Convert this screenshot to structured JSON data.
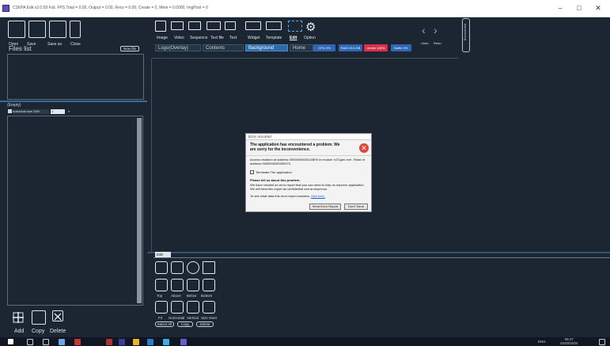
{
  "window": {
    "title": "CSKPA Edit v2.0.59 Full. FPS Total = 0.00, Output = 0.00, Recv = 0.00, Create = 0, Mem = 0.0000, ImgPool = 0",
    "minimize": "–",
    "maximize": "□",
    "close": "✕"
  },
  "file_toolbar": {
    "open": "Open",
    "save": "Save",
    "save_as": "Save as",
    "close": "Close"
  },
  "files": {
    "heading": "Files list",
    "new_file": "New file"
  },
  "layers": {
    "heading": "(Empty)",
    "checkbox_label": "Individual size 30%",
    "value": "1",
    "unit": "#"
  },
  "bottom_left": {
    "add": "Add",
    "copy": "Copy",
    "delete": "Delete"
  },
  "main_toolbar": {
    "items": [
      "Image",
      "Video",
      "Sequence",
      "Text file",
      "Text",
      "Widget",
      "Template",
      "Edit",
      "Option"
    ],
    "active": "Edit",
    "undo": "Undo",
    "redo": "Redo"
  },
  "tabs": [
    {
      "label": "Logo(Overlay)",
      "active": false
    },
    {
      "label": "Contents",
      "active": false
    },
    {
      "label": "Background",
      "active": true
    },
    {
      "label": "Home",
      "active": false
    }
  ],
  "status_pills": {
    "cpu": "CPU 0%",
    "ram": "RAM 13.6 GB",
    "render": "render 100%",
    "buffer": "Buffer 0%"
  },
  "side_label": "Disconnected",
  "dialog": {
    "title": "Error occurred",
    "heading": "The application has encountered a problem. We are sorry for the inconvenience.",
    "detail": "Access violation at address 0000000000012BF8 in module 'eZCgen.exe'. Read of address 0000000000000070.",
    "terminate": "Terminate The application",
    "tell_heading": "Please tell us about this problem.",
    "tell_body": "We have created an error report that you can send to help us improve application. We will treat this report as confidential and anonymous.",
    "see_data": "To see what data this error report contains,",
    "click_here": "click here.",
    "send": "Send Error Report",
    "dont_send": "Don't Send",
    "error_glyph": "✕"
  },
  "edit_panel": {
    "header": "Edit",
    "align_labels": [
      "Top",
      "Above",
      "Below",
      "Bottom"
    ],
    "fit_labels": [
      "Fit",
      "Horizontal",
      "Vertical",
      "Size reset"
    ],
    "select_all": "Select All",
    "copy": "Copy",
    "delete": "Delete"
  },
  "taskbar": {
    "lang": "ENG",
    "time": "08:47",
    "date": "2020/02/04"
  },
  "colors": {
    "bg": "#1b2632",
    "accent": "#2d6aa8",
    "render_pill": "#d8324a",
    "pill_blue": "#2f67b5"
  }
}
